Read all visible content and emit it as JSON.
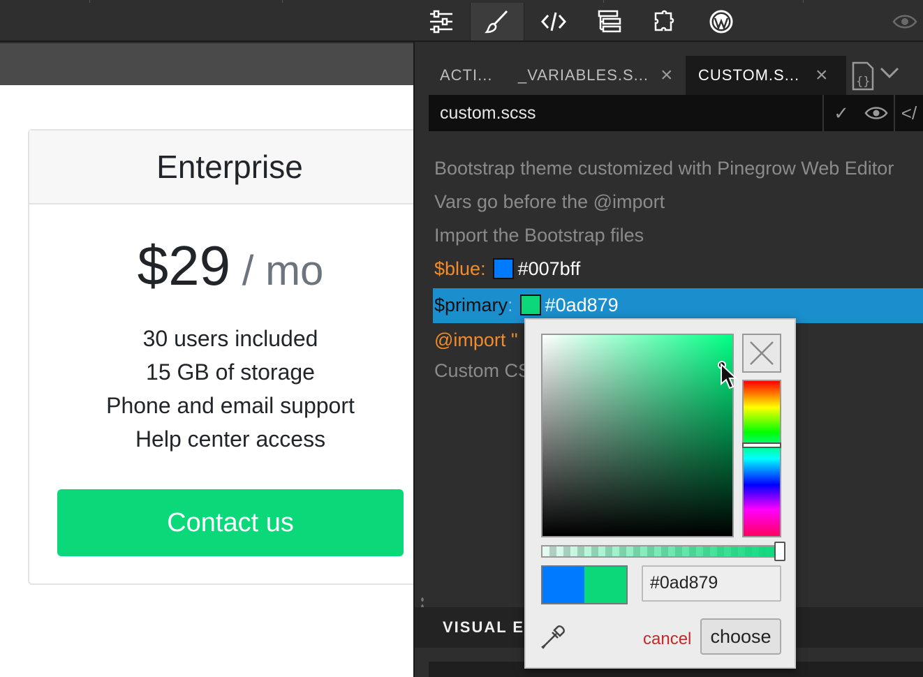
{
  "toolbar": {
    "tools": [
      {
        "name": "properties-tool",
        "icon": "sliders-icon"
      },
      {
        "name": "style-tool",
        "icon": "paintbrush-icon",
        "active": true
      },
      {
        "name": "code-tool",
        "icon": "code-icon"
      },
      {
        "name": "tree-tool",
        "icon": "tree-icon"
      },
      {
        "name": "components-tool",
        "icon": "puzzle-icon"
      },
      {
        "name": "wordpress-tool",
        "icon": "wordpress-icon"
      }
    ],
    "preview_icon": "eye-icon"
  },
  "preview": {
    "card_title": "Enterprise",
    "price_amount": "$29",
    "price_period": " / mo",
    "features": [
      "30 users included",
      "15 GB of storage",
      "Phone and email support",
      "Help center access"
    ],
    "cta_label": "Contact us",
    "cta_color": "#0ad879"
  },
  "editor": {
    "tabs": [
      {
        "label": "ACTI...",
        "closable": false,
        "active": false
      },
      {
        "label": "_VARIABLES.S...",
        "closable": true,
        "active": false
      },
      {
        "label": "CUSTOM.S...",
        "closable": true,
        "active": true
      }
    ],
    "close_glyph": "×",
    "file_name": "custom.scss",
    "code_lines": {
      "c1": "Bootstrap theme customized with Pinegrow Web Editor",
      "c2": "Vars go before the @import",
      "c3": "Import the Bootstrap files",
      "blue_var": "$blue",
      "blue_value": "#007bff",
      "primary_var": "$primary",
      "primary_value": "#0ad879",
      "import_kw": "@import",
      "import_rest": " \"",
      "c4": "Custom CS"
    },
    "colon": ":",
    "section_label": "VISUAL ED"
  },
  "picker": {
    "hex_value": "#0ad879",
    "old_color": "#007bff",
    "new_color": "#0ad879",
    "cancel_label": "cancel",
    "choose_label": "choose"
  }
}
